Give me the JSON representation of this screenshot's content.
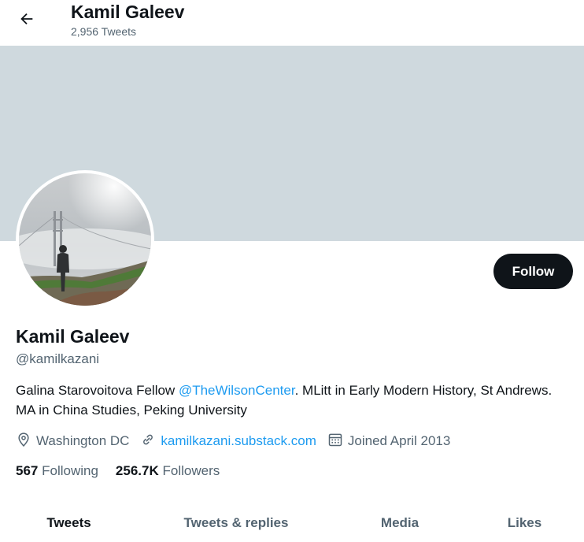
{
  "header": {
    "title": "Kamil Galeev",
    "tweet_count": "2,956 Tweets"
  },
  "profile": {
    "name": "Kamil Galeev",
    "handle": "@kamilkazani",
    "follow_label": "Follow",
    "bio": {
      "part1": "Galina Starovoitova Fellow ",
      "mention": "@TheWilsonCenter",
      "part2": ". MLitt in Early Modern History, St Andrews. MA in China Studies, Peking University"
    },
    "location": "Washington DC",
    "website": "kamilkazani.substack.com",
    "joined": "Joined April 2013",
    "following_count": "567",
    "following_label": "Following",
    "followers_count": "256.7K",
    "followers_label": "Followers"
  },
  "tabs": [
    {
      "label": "Tweets",
      "active": true
    },
    {
      "label": "Tweets & replies",
      "active": false
    },
    {
      "label": "Media",
      "active": false
    },
    {
      "label": "Likes",
      "active": false
    }
  ],
  "colors": {
    "banner": "#cfd9de",
    "link": "#1d9bf0",
    "follow_button": "#0f1419",
    "muted_text": "#536471"
  },
  "icons": {
    "back": "arrow-left-icon",
    "location": "location-pin-icon",
    "link": "link-icon",
    "calendar": "calendar-icon"
  }
}
